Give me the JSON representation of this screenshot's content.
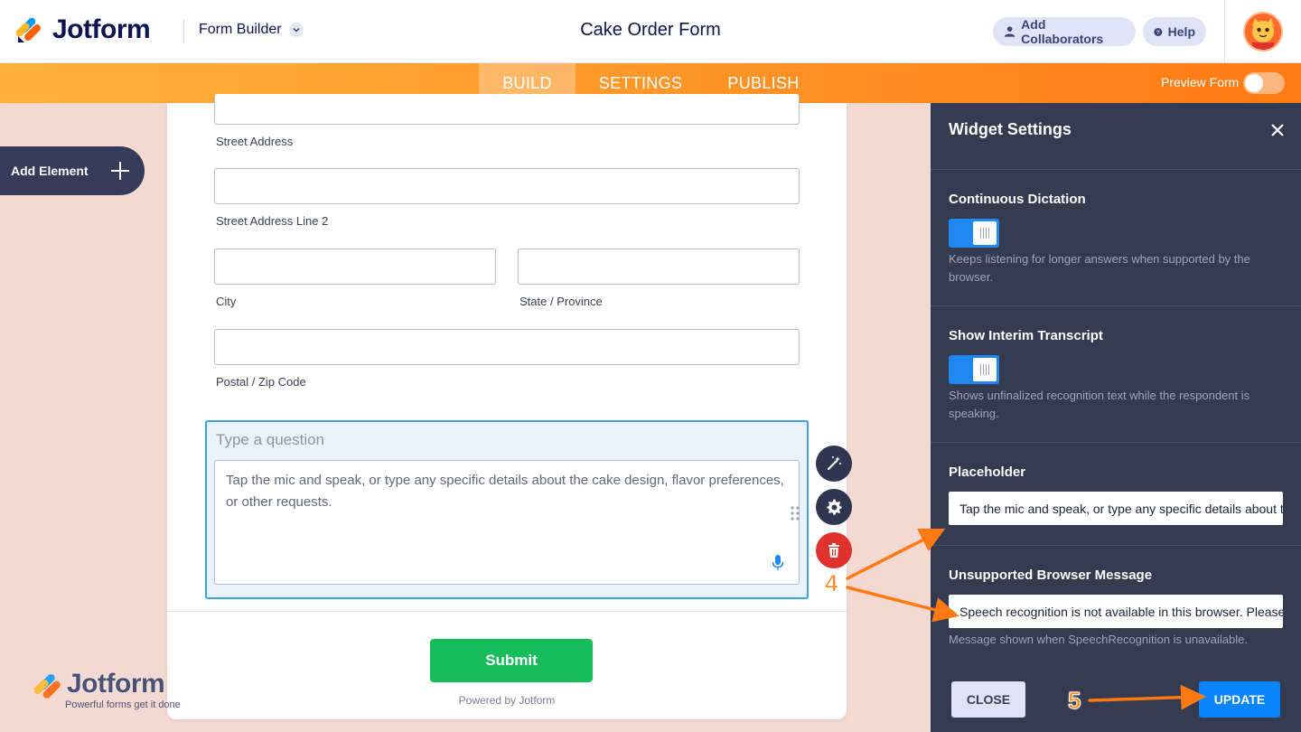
{
  "header": {
    "brand": "Jotform",
    "builder_menu": "Form Builder",
    "form_title": "Cake Order Form",
    "add_collaborators": "Add Collaborators",
    "help": "Help"
  },
  "nav": {
    "tabs": [
      "BUILD",
      "SETTINGS",
      "PUBLISH"
    ],
    "active_tab": "BUILD",
    "preview_label": "Preview Form",
    "preview_on": false
  },
  "sidebar": {
    "add_element": "Add Element"
  },
  "form": {
    "fields": {
      "street_address": "Street Address",
      "street_address_2": "Street Address Line 2",
      "city": "City",
      "state": "State / Province",
      "postal": "Postal / Zip Code"
    },
    "selected_question": {
      "placeholder": "Type a question",
      "textarea_placeholder": "Tap the mic and speak, or type any specific details about the cake design, flavor preferences, or other requests."
    },
    "submit": "Submit",
    "powered_by": "Powered by Jotform"
  },
  "watermark": {
    "brand": "Jotform",
    "tagline": "Powerful forms get it done"
  },
  "panel": {
    "title": "Widget Settings",
    "sections": [
      {
        "title": "Continuous Dictation",
        "enabled": true,
        "description": "Keeps listening for longer answers when supported by the browser."
      },
      {
        "title": "Show Interim Transcript",
        "enabled": true,
        "description": "Shows unfinalized recognition text while the respondent is speaking."
      },
      {
        "title": "Placeholder",
        "value": "Tap the mic and speak, or type any specific details about the cake design, flavor preferences, or other requests."
      },
      {
        "title": "Unsupported Browser Message",
        "value": "Speech recognition is not available in this browser. Please type your answer instead.",
        "description": "Message shown when SpeechRecognition is unavailable."
      }
    ],
    "close_button": "CLOSE",
    "update_button": "UPDATE"
  },
  "annotations": {
    "step_4": "4",
    "step_5": "5"
  },
  "colors": {
    "brand_navy": "#0a1551",
    "nav_orange": "#ff7a12",
    "submit_green": "#18bd5b",
    "update_blue": "#0a84ff",
    "panel_bg": "#343a4f",
    "annotation_orange": "#ff8a1c"
  }
}
